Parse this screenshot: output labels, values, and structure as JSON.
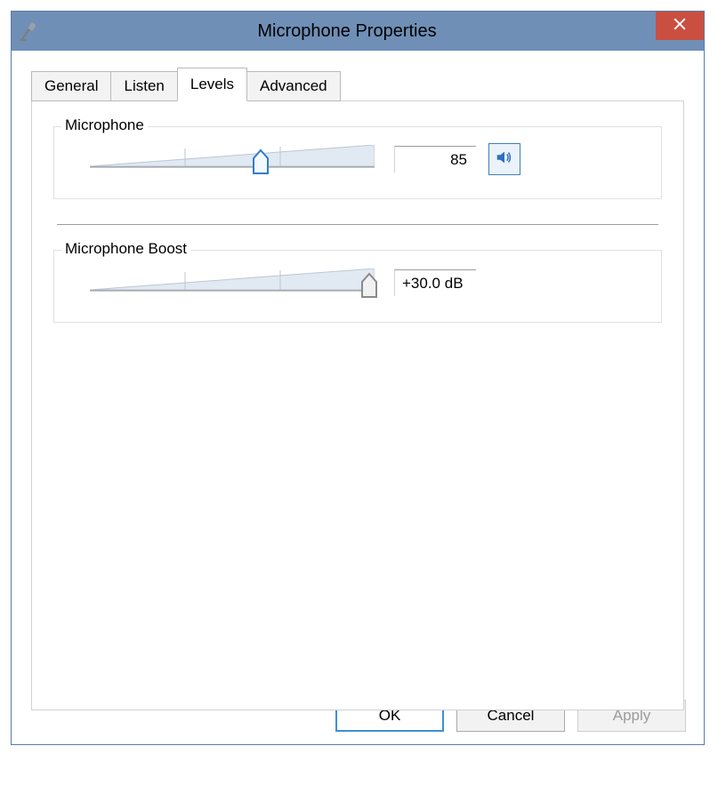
{
  "window": {
    "title": "Microphone Properties"
  },
  "tabs": [
    {
      "label": "General"
    },
    {
      "label": "Listen"
    },
    {
      "label": "Levels"
    },
    {
      "label": "Advanced"
    }
  ],
  "active_tab": "Levels",
  "sections": {
    "microphone": {
      "legend": "Microphone",
      "value": "85",
      "slider_percent": 60
    },
    "boost": {
      "legend": "Microphone Boost",
      "value": "+30.0 dB",
      "slider_percent": 98
    }
  },
  "buttons": {
    "ok": "OK",
    "cancel": "Cancel",
    "apply": "Apply"
  }
}
